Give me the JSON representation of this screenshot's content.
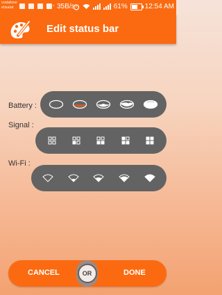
{
  "status_bar": {
    "carrier_line1": "vodafone",
    "carrier_line2": "etisalat",
    "dots": "···",
    "net_rate": "35B/s",
    "battery_percent": "61%",
    "time": "12:54 AM"
  },
  "app_bar": {
    "title": "Edit status bar"
  },
  "rows": {
    "battery": {
      "label": "Battery :",
      "styles": [
        "battery-style-1",
        "battery-style-2",
        "battery-style-3",
        "battery-style-4",
        "battery-style-5"
      ]
    },
    "signal": {
      "label": "Signal :",
      "styles": [
        "signal-style-1",
        "signal-style-2",
        "signal-style-3",
        "signal-style-4",
        "signal-style-5"
      ]
    },
    "wifi": {
      "label": "Wi-Fi :",
      "styles": [
        "wifi-style-1",
        "wifi-style-2",
        "wifi-style-3",
        "wifi-style-4",
        "wifi-style-5"
      ]
    }
  },
  "actions": {
    "cancel": "CANCEL",
    "or": "OR",
    "done": "DONE"
  },
  "colors": {
    "accent": "#fb6a10",
    "pill": "#636363",
    "icon": "#ffffff",
    "battery_accent": "#e05a1c"
  }
}
